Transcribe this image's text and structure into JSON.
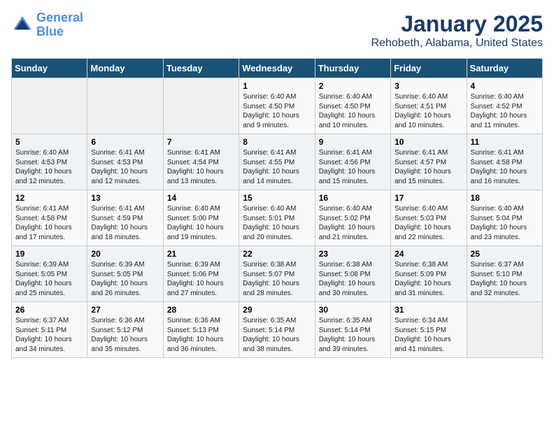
{
  "header": {
    "logo_line1": "General",
    "logo_line2": "Blue",
    "title": "January 2025",
    "subtitle": "Rehobeth, Alabama, United States"
  },
  "weekdays": [
    "Sunday",
    "Monday",
    "Tuesday",
    "Wednesday",
    "Thursday",
    "Friday",
    "Saturday"
  ],
  "weeks": [
    [
      {
        "day": "",
        "info": ""
      },
      {
        "day": "",
        "info": ""
      },
      {
        "day": "",
        "info": ""
      },
      {
        "day": "1",
        "info": "Sunrise: 6:40 AM\nSunset: 4:50 PM\nDaylight: 10 hours\nand 9 minutes."
      },
      {
        "day": "2",
        "info": "Sunrise: 6:40 AM\nSunset: 4:50 PM\nDaylight: 10 hours\nand 10 minutes."
      },
      {
        "day": "3",
        "info": "Sunrise: 6:40 AM\nSunset: 4:51 PM\nDaylight: 10 hours\nand 10 minutes."
      },
      {
        "day": "4",
        "info": "Sunrise: 6:40 AM\nSunset: 4:52 PM\nDaylight: 10 hours\nand 11 minutes."
      }
    ],
    [
      {
        "day": "5",
        "info": "Sunrise: 6:40 AM\nSunset: 4:53 PM\nDaylight: 10 hours\nand 12 minutes."
      },
      {
        "day": "6",
        "info": "Sunrise: 6:41 AM\nSunset: 4:53 PM\nDaylight: 10 hours\nand 12 minutes."
      },
      {
        "day": "7",
        "info": "Sunrise: 6:41 AM\nSunset: 4:54 PM\nDaylight: 10 hours\nand 13 minutes."
      },
      {
        "day": "8",
        "info": "Sunrise: 6:41 AM\nSunset: 4:55 PM\nDaylight: 10 hours\nand 14 minutes."
      },
      {
        "day": "9",
        "info": "Sunrise: 6:41 AM\nSunset: 4:56 PM\nDaylight: 10 hours\nand 15 minutes."
      },
      {
        "day": "10",
        "info": "Sunrise: 6:41 AM\nSunset: 4:57 PM\nDaylight: 10 hours\nand 15 minutes."
      },
      {
        "day": "11",
        "info": "Sunrise: 6:41 AM\nSunset: 4:58 PM\nDaylight: 10 hours\nand 16 minutes."
      }
    ],
    [
      {
        "day": "12",
        "info": "Sunrise: 6:41 AM\nSunset: 4:58 PM\nDaylight: 10 hours\nand 17 minutes."
      },
      {
        "day": "13",
        "info": "Sunrise: 6:41 AM\nSunset: 4:59 PM\nDaylight: 10 hours\nand 18 minutes."
      },
      {
        "day": "14",
        "info": "Sunrise: 6:40 AM\nSunset: 5:00 PM\nDaylight: 10 hours\nand 19 minutes."
      },
      {
        "day": "15",
        "info": "Sunrise: 6:40 AM\nSunset: 5:01 PM\nDaylight: 10 hours\nand 20 minutes."
      },
      {
        "day": "16",
        "info": "Sunrise: 6:40 AM\nSunset: 5:02 PM\nDaylight: 10 hours\nand 21 minutes."
      },
      {
        "day": "17",
        "info": "Sunrise: 6:40 AM\nSunset: 5:03 PM\nDaylight: 10 hours\nand 22 minutes."
      },
      {
        "day": "18",
        "info": "Sunrise: 6:40 AM\nSunset: 5:04 PM\nDaylight: 10 hours\nand 23 minutes."
      }
    ],
    [
      {
        "day": "19",
        "info": "Sunrise: 6:39 AM\nSunset: 5:05 PM\nDaylight: 10 hours\nand 25 minutes."
      },
      {
        "day": "20",
        "info": "Sunrise: 6:39 AM\nSunset: 5:05 PM\nDaylight: 10 hours\nand 26 minutes."
      },
      {
        "day": "21",
        "info": "Sunrise: 6:39 AM\nSunset: 5:06 PM\nDaylight: 10 hours\nand 27 minutes."
      },
      {
        "day": "22",
        "info": "Sunrise: 6:38 AM\nSunset: 5:07 PM\nDaylight: 10 hours\nand 28 minutes."
      },
      {
        "day": "23",
        "info": "Sunrise: 6:38 AM\nSunset: 5:08 PM\nDaylight: 10 hours\nand 30 minutes."
      },
      {
        "day": "24",
        "info": "Sunrise: 6:38 AM\nSunset: 5:09 PM\nDaylight: 10 hours\nand 31 minutes."
      },
      {
        "day": "25",
        "info": "Sunrise: 6:37 AM\nSunset: 5:10 PM\nDaylight: 10 hours\nand 32 minutes."
      }
    ],
    [
      {
        "day": "26",
        "info": "Sunrise: 6:37 AM\nSunset: 5:11 PM\nDaylight: 10 hours\nand 34 minutes."
      },
      {
        "day": "27",
        "info": "Sunrise: 6:36 AM\nSunset: 5:12 PM\nDaylight: 10 hours\nand 35 minutes."
      },
      {
        "day": "28",
        "info": "Sunrise: 6:36 AM\nSunset: 5:13 PM\nDaylight: 10 hours\nand 36 minutes."
      },
      {
        "day": "29",
        "info": "Sunrise: 6:35 AM\nSunset: 5:14 PM\nDaylight: 10 hours\nand 38 minutes."
      },
      {
        "day": "30",
        "info": "Sunrise: 6:35 AM\nSunset: 5:14 PM\nDaylight: 10 hours\nand 39 minutes."
      },
      {
        "day": "31",
        "info": "Sunrise: 6:34 AM\nSunset: 5:15 PM\nDaylight: 10 hours\nand 41 minutes."
      },
      {
        "day": "",
        "info": ""
      }
    ]
  ]
}
